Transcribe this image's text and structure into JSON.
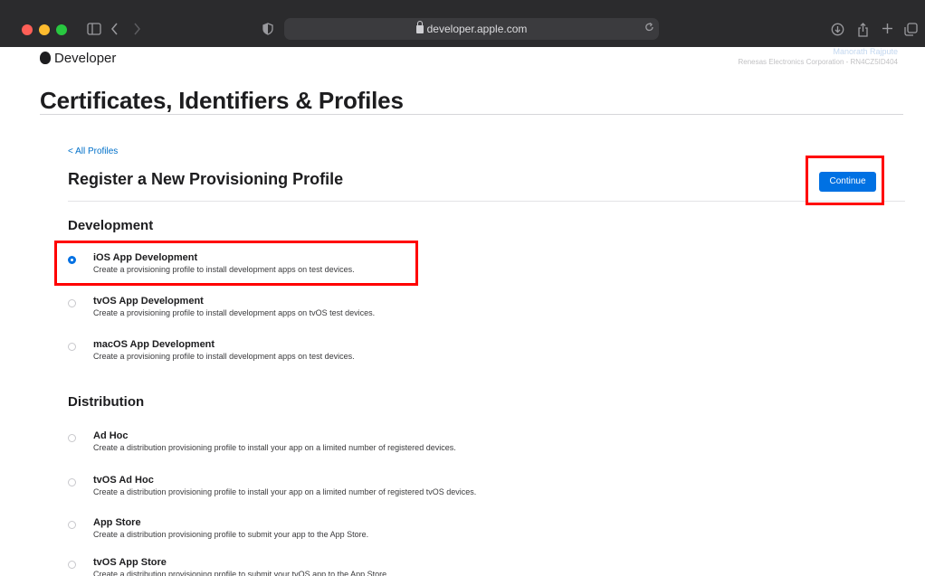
{
  "browser": {
    "url": "developer.apple.com"
  },
  "header": {
    "logo_text": "Developer",
    "account_team": "Manorath Rajpute",
    "account_org": "Renesas Electronics Corporation - RN4CZ5ID404"
  },
  "page": {
    "title": "Certificates, Identifiers & Profiles",
    "back_link": "< All Profiles",
    "subtitle": "Register a New Provisioning Profile",
    "continue_label": "Continue"
  },
  "sections": {
    "development": {
      "title": "Development",
      "options": [
        {
          "title": "iOS App Development",
          "desc": "Create a provisioning profile to install development apps on test devices.",
          "selected": true
        },
        {
          "title": "tvOS App Development",
          "desc": "Create a provisioning profile to install development apps on tvOS test devices.",
          "selected": false
        },
        {
          "title": "macOS App Development",
          "desc": "Create a provisioning profile to install development apps on test devices.",
          "selected": false
        }
      ]
    },
    "distribution": {
      "title": "Distribution",
      "options": [
        {
          "title": "Ad Hoc",
          "desc": "Create a distribution provisioning profile to install your app on a limited number of registered devices.",
          "selected": false
        },
        {
          "title": "tvOS Ad Hoc",
          "desc": "Create a distribution provisioning profile to install your app on a limited number of registered tvOS devices.",
          "selected": false
        },
        {
          "title": "App Store",
          "desc": "Create a distribution provisioning profile to submit your app to the App Store.",
          "selected": false
        },
        {
          "title": "tvOS App Store",
          "desc": "Create a distribution provisioning profile to submit your tvOS app to the App Store.",
          "selected": false
        }
      ]
    }
  },
  "colors": {
    "accent": "#0071e3",
    "highlight": "#ff0000",
    "toolbar": "#2b2b2d"
  }
}
